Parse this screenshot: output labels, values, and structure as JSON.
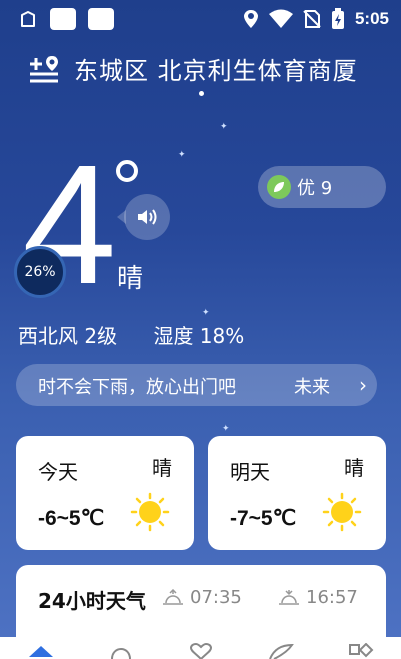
{
  "status_bar": {
    "time": "5:05",
    "icons": [
      "clipboard-icon",
      "app-square-icon",
      "app-square-icon",
      "location-icon",
      "wifi-icon",
      "no-sim-icon",
      "battery-charging-icon"
    ]
  },
  "header": {
    "location": "东城区 北京利生体育商厦",
    "add_location_icon": "add-location-icon"
  },
  "current": {
    "temperature": "4",
    "weather": "晴",
    "humidity_gauge": "26%",
    "humidity_gauge_fraction": 0.26,
    "wind": "西北风 2级",
    "humidity": "湿度 18%"
  },
  "aqi": {
    "label": "优 9",
    "icon": "leaf-icon",
    "color": "#7dc95b"
  },
  "tip": {
    "text": "时不会下雨，放心出门吧",
    "next": "未来",
    "arrow": "›"
  },
  "forecast": [
    {
      "day": "今天",
      "weather": "晴",
      "range": "-6~5℃",
      "icon": "sun-icon"
    },
    {
      "day": "明天",
      "weather": "晴",
      "range": "-7~5℃",
      "icon": "sun-icon"
    }
  ],
  "hourly": {
    "title": "24小时天气",
    "sunrise": "07:35",
    "sunset": "16:57"
  },
  "bottom_nav": [
    "home-icon",
    "cloud-icon",
    "heart-icon",
    "leaf-nav-icon",
    "grid-icon"
  ],
  "colors": {
    "background_top": "#1f3f8c",
    "background_bottom": "#4f73c4",
    "sun": "#ffd21a",
    "nav_accent": "#2f6fe0"
  }
}
